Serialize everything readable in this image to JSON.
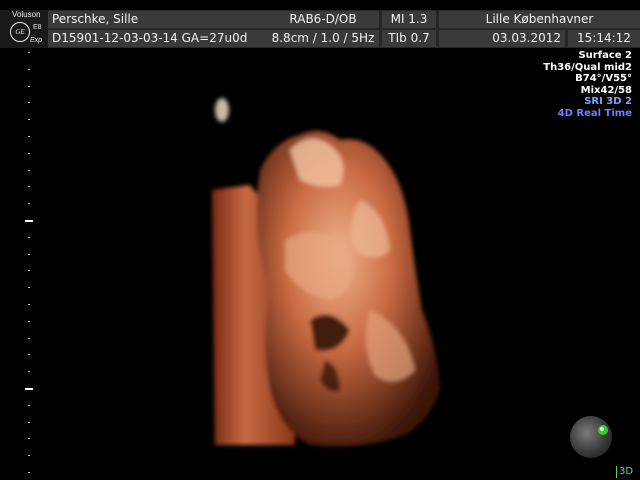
{
  "branding": {
    "brand": "Voluson",
    "logo": "GE",
    "model": "E8",
    "edition": "Exp"
  },
  "header": {
    "row1": {
      "patient_name": "Perschke, Sille",
      "probe_preset": "RAB6-D/OB",
      "mi": "MI  1.3",
      "institution": "Lille Københavner"
    },
    "row2": {
      "patient_id": "D15901-12-03-03-14  GA=27u0d",
      "depth_freq": "8.8cm / 1.0 /  5Hz",
      "tib": "TIb  0.7",
      "date": "03.03.2012",
      "time": "15:14:12"
    }
  },
  "image_info": {
    "surface": "Surface 2",
    "threshold": "Th36/Qual mid2",
    "angles": "B74°/V55°",
    "mix": "Mix42/58",
    "sri": "SRI 3D 2",
    "mode": "4D Real Time"
  },
  "colors": {
    "header_bg": "#262626",
    "cell_bg": "#3a3a3a",
    "sri_text": "#7aa8ff",
    "mode_text": "#6f7dff",
    "accent_green": "#5ad85a",
    "skin_tone": "#c4623c"
  },
  "depth_scale": {
    "major_tick_labels": []
  },
  "orientation": {
    "icon": "orientation-ball-icon",
    "label": "3D"
  }
}
